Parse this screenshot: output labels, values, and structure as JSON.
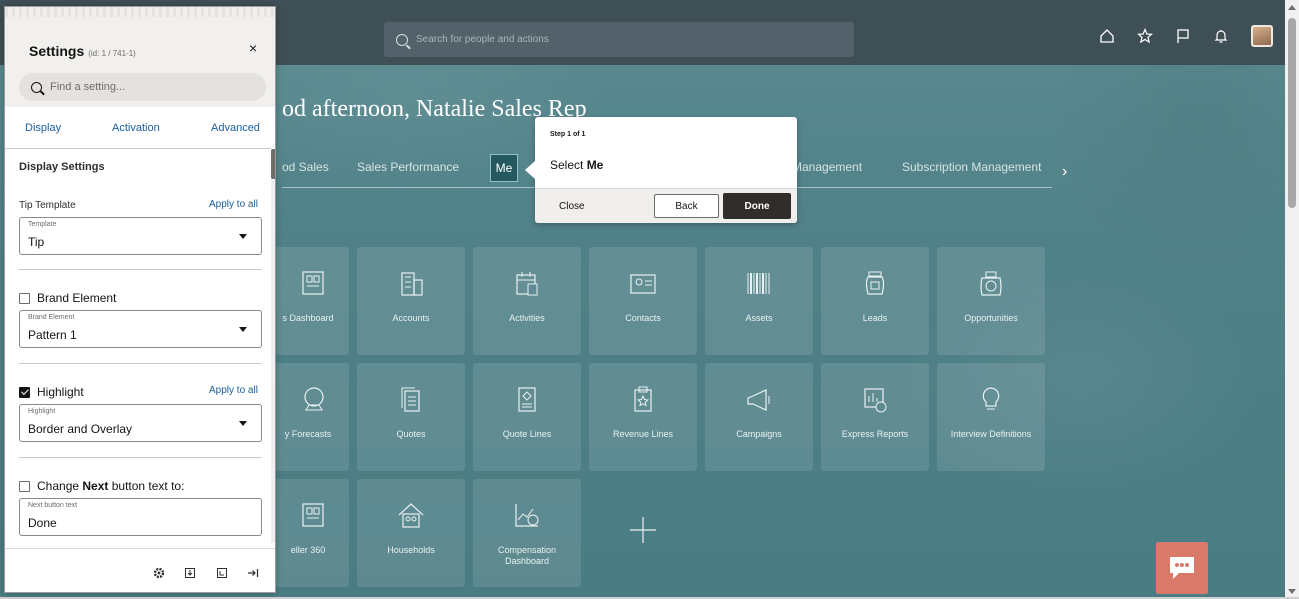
{
  "topbar": {
    "search_placeholder": "Search for people and actions",
    "icons": [
      "home-icon",
      "star-icon",
      "flag-icon",
      "bell-icon",
      "avatar"
    ]
  },
  "greeting": "od afternoon, Natalie Sales Rep",
  "tabs": {
    "items": [
      "od Sales",
      "Sales Performance",
      "Me",
      "Management",
      "Subscription Management"
    ],
    "active": "Me"
  },
  "tiles": [
    {
      "label": "s Dashboard",
      "icon": "dashboard-icon"
    },
    {
      "label": "Accounts",
      "icon": "building-icon"
    },
    {
      "label": "Activities",
      "icon": "calendar-icon"
    },
    {
      "label": "Contacts",
      "icon": "contact-card-icon"
    },
    {
      "label": "Assets",
      "icon": "barcode-icon"
    },
    {
      "label": "Leads",
      "icon": "jar-icon"
    },
    {
      "label": "Opportunities",
      "icon": "bank-icon"
    },
    {
      "label": "y Forecasts",
      "icon": "crystal-ball-icon"
    },
    {
      "label": "Quotes",
      "icon": "documents-icon"
    },
    {
      "label": "Quote Lines",
      "icon": "quote-lines-icon"
    },
    {
      "label": "Revenue Lines",
      "icon": "clipboard-star-icon"
    },
    {
      "label": "Campaigns",
      "icon": "megaphone-icon"
    },
    {
      "label": "Express Reports",
      "icon": "report-icon"
    },
    {
      "label": "Interview Definitions",
      "icon": "lightbulb-icon"
    },
    {
      "label": "eller 360",
      "icon": "dashboard-icon"
    },
    {
      "label": "Households",
      "icon": "house-icon"
    },
    {
      "label": "Compensation Dashboard",
      "icon": "compensation-chart-icon"
    }
  ],
  "add_tile_icon": "plus-icon",
  "callout": {
    "step": "Step 1 of 1",
    "text_prefix": "Select ",
    "text_bold": "Me",
    "close_label": "Close",
    "back_label": "Back",
    "done_label": "Done"
  },
  "settings": {
    "title": "Settings",
    "id": "(id: 1 / 741-1)",
    "close": "×",
    "find_placeholder": "Find a setting...",
    "tabs": [
      "Display",
      "Activation",
      "Advanced"
    ],
    "section_title": "Display Settings",
    "tip_template_label": "Tip Template",
    "apply_to_all": "Apply to all",
    "template_caption": "Template",
    "template_value": "Tip",
    "brand_element_label": "Brand Element",
    "brand_element_caption": "Brand Element",
    "brand_element_value": "Pattern 1",
    "brand_element_checked": false,
    "highlight_label": "Highlight",
    "highlight_checked": true,
    "highlight_caption": "Highlight",
    "highlight_value": "Border and Overlay",
    "change_next_prefix": "Change ",
    "change_next_bold": "Next",
    "change_next_suffix": " button text to:",
    "change_next_checked": false,
    "next_button_caption": "Next button text",
    "next_button_value": "Done"
  },
  "footer_icons": [
    "gear-icon",
    "export-icon",
    "import-icon",
    "sign-out-icon"
  ],
  "colors": {
    "accent_link": "#1a5e9a",
    "topbar": "#3f4f56",
    "background": "#4e7f86",
    "done_button": "#312d2a",
    "chat_button": "#d9796a"
  }
}
